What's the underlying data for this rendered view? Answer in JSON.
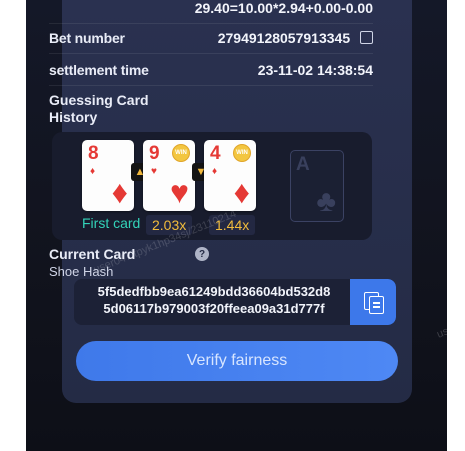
{
  "summary": {
    "formula": "29.40=10.00*2.94+0.00-0.00",
    "bet_number_label": "Bet number",
    "bet_number_value": "27949128057913345",
    "settlement_label": "settlement time",
    "settlement_value": "23-11-02 14:38:54"
  },
  "history": {
    "label": "Guessing Card History",
    "cards": [
      {
        "rank": "8",
        "suit": "♦",
        "win": false
      },
      {
        "rank": "9",
        "suit": "♥",
        "win": true,
        "win_text": "WIN"
      },
      {
        "rank": "4",
        "suit": "♦",
        "win": true,
        "win_text": "WIN"
      }
    ],
    "ghost_card": {
      "rank": "A",
      "suit": "♣"
    },
    "arrows": [
      "up-arrow-icon",
      "down-arrow-icon"
    ],
    "first_card_label": "First card",
    "multipliers": [
      "2.03x",
      "1.44x"
    ],
    "colors": {
      "red_suit": "#e53935",
      "first_card": "#33d3b9",
      "multiplier": "#f1bc3c"
    }
  },
  "current": {
    "label": "Current Card",
    "sub_label": "Shoe Hash",
    "hash_line1": "5f5dedfbb9ea61249bdd36604bd532d8",
    "hash_line2": "5d06117b979003f20ffeea09a31d777f"
  },
  "verify_button_label": "Verify fairness",
  "watermark": "user047/tpyk1hp34sj/23110214",
  "watermark2": "us",
  "accent_color": "#3d78ea"
}
